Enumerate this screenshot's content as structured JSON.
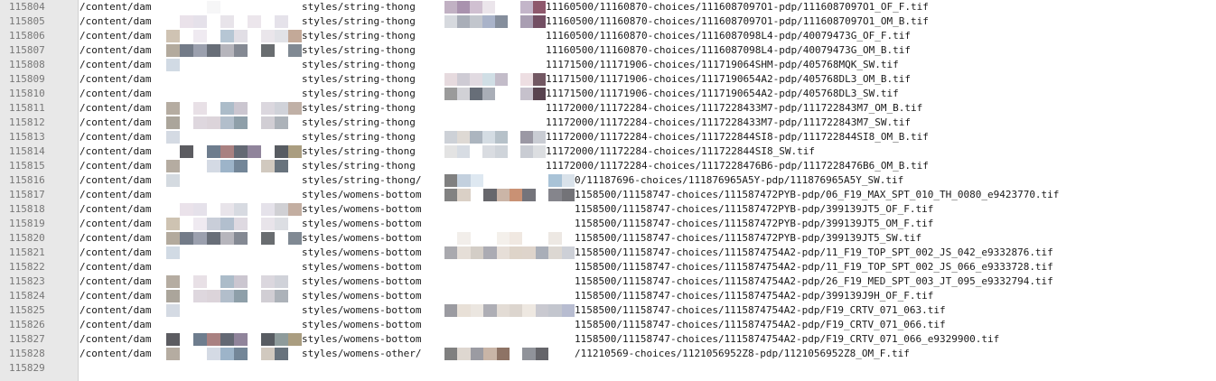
{
  "editor": {
    "lines": [
      {
        "num": "115804",
        "c1": "/content/dam",
        "c2": "styles/string-thong",
        "c3": "11160500/11160870-choices/1116087097O1-pdp/1116087097O1_OF_F.tif",
        "wide": false,
        "p1": [
          "#ffffff",
          "#ffffff",
          "#ffffff",
          "#f4f4f6",
          "#ffffff",
          "#ffffff",
          "#ffffff",
          "#ffffff",
          "#ffffff",
          "#ffffff"
        ],
        "p2": [
          "#b6a3b8",
          "#9a7fa0",
          "#c8b5c9",
          "#e8e0e8",
          "#ffffff",
          "#ffffff",
          "#b8a8bf",
          "#7a3b52"
        ]
      },
      {
        "num": "115805",
        "c1": "/content/dam",
        "c2": "styles/string-thong",
        "c3": "11160500/11160870-choices/1116087097O1-pdp/1116087097O1_OM_B.tif",
        "wide": false,
        "p1": [
          "#ffffff",
          "#e6dde6",
          "#e0dce6",
          "#ffffff",
          "#e4dfe6",
          "#ffffff",
          "#e9e2e9",
          "#ffffff",
          "#e0dde6",
          "#ffffff"
        ],
        "p2": [
          "#cfd2d8",
          "#9aa0ab",
          "#b7bcc4",
          "#9aa6c0",
          "#707a8b",
          "#ffffff",
          "#9a8da5",
          "#5a3048"
        ]
      },
      {
        "num": "115806",
        "c1": "/content/dam",
        "c2": "styles/string-thong",
        "c3": "11160500/11160870-choices/1116087098L4-pdp/40079473G_OF_F.tif",
        "wide": false,
        "p1": [
          "#c7b9a6",
          "#ffffff",
          "#ece6ee",
          "#ffffff",
          "#a9bccd",
          "#dcd8e0",
          "#ffffff",
          "#e6e2e8",
          "#dcdde3",
          "#b89a86"
        ],
        "p2": [
          "#ffffff",
          "#ffffff",
          "#ffffff",
          "#ffffff",
          "#ffffff",
          "#ffffff",
          "#ffffff",
          "#ffffff"
        ]
      },
      {
        "num": "115807",
        "c1": "/content/dam",
        "c2": "styles/string-thong",
        "c3": "11160500/11160870-choices/1116087098L4-pdp/40079473G_OM_B.tif",
        "wide": false,
        "p1": [
          "#a69b8c",
          "#5a6473",
          "#8a8fa0",
          "#4e5560",
          "#a9a8b0",
          "#6e7480",
          "#ffffff",
          "#4f5357",
          "#ffffff",
          "#6a7480"
        ],
        "p2": [
          "#ffffff",
          "#ffffff",
          "#ffffff",
          "#ffffff",
          "#ffffff",
          "#ffffff",
          "#ffffff",
          "#ffffff"
        ]
      },
      {
        "num": "115808",
        "c1": "/content/dam",
        "c2": "styles/string-thong",
        "c3": "11171500/11171906-choices/111719064SHM-pdp/405768MQK_SW.tif",
        "wide": false,
        "p1": [
          "#c9d3df",
          "#ffffff",
          "#ffffff",
          "#ffffff",
          "#ffffff",
          "#ffffff",
          "#ffffff",
          "#ffffff",
          "#ffffff",
          "#ffffff"
        ],
        "p2": [
          "#ffffff",
          "#ffffff",
          "#ffffff",
          "#ffffff",
          "#ffffff",
          "#ffffff",
          "#ffffff",
          "#ffffff"
        ]
      },
      {
        "num": "115809",
        "c1": "/content/dam",
        "c2": "styles/string-thong",
        "c3": "11171500/11171906-choices/1117190654A2-pdp/405768DL3_OM_B.tif",
        "wide": false,
        "p1": [
          "#ffffff",
          "#ffffff",
          "#ffffff",
          "#ffffff",
          "#ffffff",
          "#ffffff",
          "#ffffff",
          "#ffffff",
          "#ffffff",
          "#ffffff"
        ],
        "p2": [
          "#e2d4d8",
          "#c6c2cc",
          "#dcd4dc",
          "#c8d8e0",
          "#b9b0c0",
          "#ffffff",
          "#ead8dd",
          "#5a3b48"
        ]
      },
      {
        "num": "115810",
        "c1": "/content/dam",
        "c2": "styles/string-thong",
        "c3": "11171500/11171906-choices/1117190654A2-pdp/405768DL3_SW.tif",
        "wide": false,
        "p1": [
          "#ffffff",
          "#ffffff",
          "#ffffff",
          "#ffffff",
          "#ffffff",
          "#ffffff",
          "#ffffff",
          "#ffffff",
          "#ffffff",
          "#ffffff"
        ],
        "p2": [
          "#8a8a8a",
          "#c9c9cf",
          "#4c5560",
          "#9aa0aa",
          "#ffffff",
          "#ffffff",
          "#bcb6c3",
          "#3b2230"
        ]
      },
      {
        "num": "115811",
        "c1": "/content/dam",
        "c2": "styles/string-thong",
        "c3": "11172000/11172284-choices/1117228433M7-pdp/111722843M7_OM_B.tif",
        "wide": false,
        "p1": [
          "#a89e90",
          "#ffffff",
          "#e4dbe2",
          "#ffffff",
          "#9eb0c0",
          "#c2bcc8",
          "#ffffff",
          "#d5d0d8",
          "#c8cad2",
          "#b5a296"
        ],
        "p2": [
          "#ffffff",
          "#ffffff",
          "#ffffff",
          "#ffffff",
          "#ffffff",
          "#ffffff",
          "#ffffff",
          "#ffffff"
        ]
      },
      {
        "num": "115812",
        "c1": "/content/dam",
        "c2": "styles/string-thong",
        "c3": "11172000/11172284-choices/1117228433M7-pdp/111722843M7_SW.tif",
        "wide": false,
        "p1": [
          "#9c958a",
          "#ffffff",
          "#d8d0d8",
          "#d6cdd4",
          "#a5b3c2",
          "#7a8e9a",
          "#ffffff",
          "#c9c5cc",
          "#9ea4ad",
          "#ffffff"
        ],
        "p2": [
          "#ffffff",
          "#ffffff",
          "#ffffff",
          "#ffffff",
          "#ffffff",
          "#ffffff",
          "#ffffff",
          "#ffffff"
        ]
      },
      {
        "num": "115813",
        "c1": "/content/dam",
        "c2": "styles/string-thong",
        "c3": "11172000/11172284-choices/111722844SI8-pdp/111722844SI8_OM_B.tif",
        "wide": false,
        "p1": [
          "#ccd4de",
          "#ffffff",
          "#ffffff",
          "#ffffff",
          "#ffffff",
          "#ffffff",
          "#ffffff",
          "#ffffff",
          "#ffffff",
          "#ffffff"
        ],
        "p2": [
          "#c4c9d0",
          "#d8d2cc",
          "#9ea8b4",
          "#ccd6de",
          "#a9b6c0",
          "#ffffff",
          "#8a8694",
          "#bfc3cb"
        ]
      },
      {
        "num": "115814",
        "c1": "/content/dam",
        "c2": "styles/string-thong",
        "c3": "11172000/11172284-choices/111722844SI8_SW.tif",
        "wide": false,
        "p1": [
          "#ffffff",
          "#3f3f45",
          "#ffffff",
          "#55667a",
          "#9a6b6b",
          "#494f5c",
          "#7c6e8a",
          "#ffffff",
          "#3b3f47",
          "#9b8c6a"
        ],
        "p2": [
          "#dedede",
          "#d0d6de",
          "#ffffff",
          "#d2d6dc",
          "#c7ccd4",
          "#ffffff",
          "#bfc3cb",
          "#d6d8dc"
        ]
      },
      {
        "num": "115815",
        "c1": "/content/dam",
        "c2": "styles/string-thong",
        "c3": "11172000/11172284-choices/1117228476B6-pdp/1117228476B6_OM_B.tif",
        "wide": false,
        "p1": [
          "#a89e90",
          "#ffffff",
          "#ffffff",
          "#cdd4df",
          "#8ca7c0",
          "#5b7186",
          "#ffffff",
          "#c9c0b4",
          "#4e5a66",
          "#ffffff"
        ],
        "p2": [
          "#ffffff",
          "#ffffff",
          "#ffffff",
          "#ffffff",
          "#ffffff",
          "#ffffff",
          "#ffffff",
          "#ffffff"
        ]
      },
      {
        "num": "115816",
        "c1": "/content/dam",
        "c2": "styles/string-thong/",
        "c3": "0/11187696-choices/111876965A5Y-pdp/111876965A5Y_SW.tif",
        "wide": true,
        "p1": [
          "#cdd3da",
          "#ffffff",
          "#ffffff",
          "#ffffff",
          "#ffffff",
          "#ffffff",
          "#ffffff",
          "#ffffff",
          "#ffffff",
          "#ffffff"
        ],
        "p2": [
          "#6a6a6a",
          "#b8c8d8",
          "#d8e4ee",
          "#ffffff",
          "#ffffff",
          "#ffffff",
          "#ffffff",
          "#ffffff",
          "#9ab8d0",
          "#d2dde6"
        ]
      },
      {
        "num": "115817",
        "c1": "/content/dam",
        "c2": "styles/womens-bottom",
        "c3": "1158500/11158747-choices/111587472PYB-pdp/06_F19_MAX_SPT_010_TH_0080_e9423770.tif",
        "wide": true,
        "p1": [
          "#ffffff",
          "#ffffff",
          "#ffffff",
          "#ffffff",
          "#ffffff",
          "#ffffff",
          "#ffffff",
          "#ffffff",
          "#ffffff",
          "#ffffff"
        ],
        "p2": [
          "#6c6c6c",
          "#d4c8bc",
          "#ffffff",
          "#4c4c52",
          "#c2a898",
          "#bf7e5c",
          "#5c5c64",
          "#ffffff",
          "#707078",
          "#5a5a60"
        ]
      },
      {
        "num": "115818",
        "c1": "/content/dam",
        "c2": "styles/womens-bottom",
        "c3": "1158500/11158747-choices/111587472PYB-pdp/399139JT5_OF_F.tif",
        "wide": true,
        "p1": [
          "#ffffff",
          "#e6dde6",
          "#e0dce6",
          "#ffffff",
          "#e4dfe6",
          "#d0d4dc",
          "#ffffff",
          "#e0dde6",
          "#c8c8cc",
          "#b8a090"
        ],
        "p2": [
          "#ffffff",
          "#ffffff",
          "#ffffff",
          "#ffffff",
          "#ffffff",
          "#ffffff",
          "#ffffff",
          "#ffffff",
          "#ffffff",
          "#ffffff"
        ]
      },
      {
        "num": "115819",
        "c1": "/content/dam",
        "c2": "styles/womens-bottom",
        "c3": "1158500/11158747-choices/111587472PYB-pdp/399139JT5_OM_F.tif",
        "wide": true,
        "p1": [
          "#c5b8a4",
          "#ffffff",
          "#ece6ee",
          "#bfc6d2",
          "#a5b4c6",
          "#d8d2dc",
          "#ffffff",
          "#e4dfe6",
          "#d6d8de",
          "#ffffff"
        ],
        "p2": [
          "#ffffff",
          "#ffffff",
          "#ffffff",
          "#ffffff",
          "#ffffff",
          "#ffffff",
          "#ffffff",
          "#ffffff",
          "#ffffff",
          "#ffffff"
        ]
      },
      {
        "num": "115820",
        "c1": "/content/dam",
        "c2": "styles/womens-bottom",
        "c3": "1158500/11158747-choices/111587472PYB-pdp/399139JT5_SW.tif",
        "wide": true,
        "p1": [
          "#a69b8c",
          "#5a6473",
          "#8a8fa0",
          "#4e5560",
          "#a9a8b0",
          "#6e7480",
          "#ffffff",
          "#4f5357",
          "#ffffff",
          "#6a7480"
        ],
        "p2": [
          "#ffffff",
          "#f0ebe6",
          "#ffffff",
          "#ffffff",
          "#f2ede8",
          "#ede4dc",
          "#ffffff",
          "#ffffff",
          "#eae4de",
          "#ffffff"
        ]
      },
      {
        "num": "115821",
        "c1": "/content/dam",
        "c2": "styles/womens-bottom",
        "c3": "1158500/11158747-choices/1115874754A2-pdp/11_F19_TOP_SPT_002_JS_042_e9332876.tif",
        "wide": true,
        "p1": [
          "#c9d3df",
          "#ffffff",
          "#ffffff",
          "#ffffff",
          "#ffffff",
          "#ffffff",
          "#ffffff",
          "#ffffff",
          "#ffffff",
          "#ffffff"
        ],
        "p2": [
          "#9a9aa0",
          "#e0d8d0",
          "#cbc4bc",
          "#9c9ca6",
          "#e2d8d0",
          "#d8ccc0",
          "#d8ccc2",
          "#9aa0ac",
          "#d6d0ca",
          "#c4c8d0"
        ]
      },
      {
        "num": "115822",
        "c1": "/content/dam",
        "c2": "styles/womens-bottom",
        "c3": "1158500/11158747-choices/1115874754A2-pdp/11_F19_TOP_SPT_002_JS_066_e9333728.tif",
        "wide": true,
        "p1": [
          "#ffffff",
          "#ffffff",
          "#ffffff",
          "#ffffff",
          "#ffffff",
          "#ffffff",
          "#ffffff",
          "#ffffff",
          "#ffffff",
          "#ffffff"
        ],
        "p2": [
          "#ffffff",
          "#ffffff",
          "#ffffff",
          "#ffffff",
          "#ffffff",
          "#ffffff",
          "#ffffff",
          "#ffffff",
          "#ffffff",
          "#ffffff"
        ]
      },
      {
        "num": "115823",
        "c1": "/content/dam",
        "c2": "styles/womens-bottom",
        "c3": "1158500/11158747-choices/1115874754A2-pdp/26_F19_MED_SPT_003_JT_095_e9332794.tif",
        "wide": true,
        "p1": [
          "#a89e90",
          "#ffffff",
          "#e4dbe2",
          "#ffffff",
          "#9eb0c0",
          "#c2bcc8",
          "#ffffff",
          "#d5d0d8",
          "#c8cad2",
          "#ffffff"
        ],
        "p2": [
          "#ffffff",
          "#ffffff",
          "#ffffff",
          "#ffffff",
          "#ffffff",
          "#ffffff",
          "#ffffff",
          "#ffffff",
          "#ffffff",
          "#ffffff"
        ]
      },
      {
        "num": "115824",
        "c1": "/content/dam",
        "c2": "styles/womens-bottom",
        "c3": "1158500/11158747-choices/1115874754A2-pdp/399139J9H_OF_F.tif",
        "wide": true,
        "p1": [
          "#9c958a",
          "#ffffff",
          "#d8d0d8",
          "#d6cdd4",
          "#a5b3c2",
          "#7a8e9a",
          "#ffffff",
          "#c9c5cc",
          "#9ea4ad",
          "#ffffff"
        ],
        "p2": [
          "#ffffff",
          "#ffffff",
          "#ffffff",
          "#ffffff",
          "#ffffff",
          "#ffffff",
          "#ffffff",
          "#ffffff",
          "#ffffff",
          "#ffffff"
        ]
      },
      {
        "num": "115825",
        "c1": "/content/dam",
        "c2": "styles/womens-bottom",
        "c3": "1158500/11158747-choices/1115874754A2-pdp/F19_CRTV_071_063.tif",
        "wide": true,
        "p1": [
          "#ccd4de",
          "#ffffff",
          "#ffffff",
          "#ffffff",
          "#ffffff",
          "#ffffff",
          "#ffffff",
          "#ffffff",
          "#ffffff",
          "#ffffff"
        ],
        "p2": [
          "#8a8a90",
          "#e4dad0",
          "#e8e2da",
          "#a0a0a8",
          "#ded6ce",
          "#d6cec6",
          "#ebe4dc",
          "#c0c0c8",
          "#b8bcc6",
          "#aab0c8"
        ]
      },
      {
        "num": "115826",
        "c1": "/content/dam",
        "c2": "styles/womens-bottom",
        "c3": "1158500/11158747-choices/1115874754A2-pdp/F19_CRTV_071_066.tif",
        "wide": true,
        "p1": [
          "#ffffff",
          "#ffffff",
          "#ffffff",
          "#ffffff",
          "#ffffff",
          "#ffffff",
          "#ffffff",
          "#ffffff",
          "#ffffff",
          "#ffffff"
        ],
        "p2": [
          "#ffffff",
          "#ffffff",
          "#ffffff",
          "#ffffff",
          "#ffffff",
          "#ffffff",
          "#ffffff",
          "#ffffff",
          "#ffffff",
          "#ffffff"
        ]
      },
      {
        "num": "115827",
        "c1": "/content/dam",
        "c2": "styles/womens-bottom",
        "c3": "1158500/11158747-choices/1115874754A2-pdp/F19_CRTV_071_066_e9329900.tif",
        "wide": true,
        "p1": [
          "#3f3f45",
          "#ffffff",
          "#55667a",
          "#9a6b6b",
          "#494f5c",
          "#7c6e8a",
          "#ffffff",
          "#3b3f47",
          "#7a8a8a",
          "#9b8c6a"
        ],
        "p2": [
          "#ffffff",
          "#ffffff",
          "#ffffff",
          "#ffffff",
          "#ffffff",
          "#ffffff",
          "#ffffff",
          "#ffffff",
          "#ffffff",
          "#ffffff"
        ]
      },
      {
        "num": "115828",
        "c1": "/content/dam",
        "c2": "styles/womens-other/",
        "c3": "/11210569-choices/1121056952Z8-pdp/1121056952Z8_OM_F.tif",
        "wide": true,
        "p1": [
          "#a89e90",
          "#ffffff",
          "#ffffff",
          "#cdd4df",
          "#8ca7c0",
          "#5b7186",
          "#ffffff",
          "#c9c0b4",
          "#4e5a66",
          "#ffffff"
        ],
        "p2": [
          "#6a6a6a",
          "#d8d0c8",
          "#8a8a92",
          "#c0a898",
          "#7a5a4a",
          "#ffffff",
          "#7c8088",
          "#4a4a50",
          "#ffffff",
          "#ffffff"
        ]
      },
      {
        "num": "115829",
        "c1": "",
        "c2": "",
        "c3": "",
        "wide": false,
        "p1": [],
        "p2": []
      }
    ]
  }
}
